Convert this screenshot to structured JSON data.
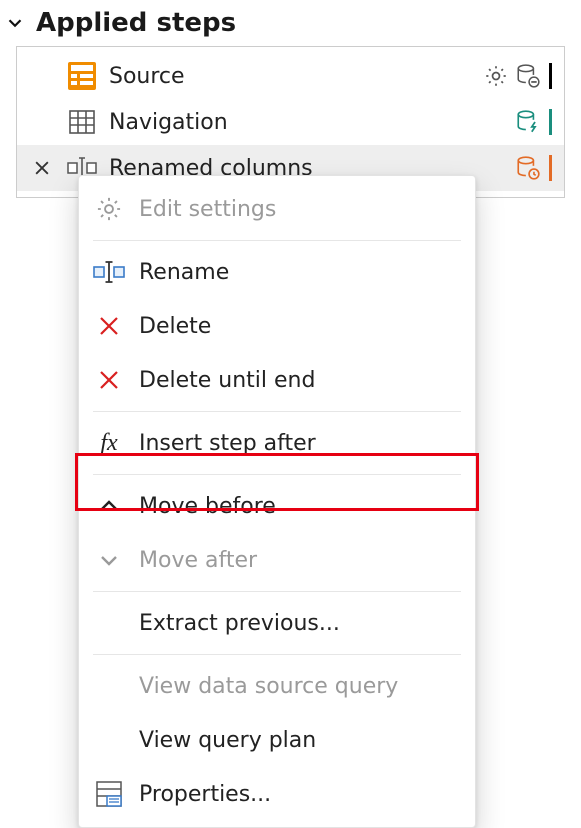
{
  "header": {
    "title": "Applied steps"
  },
  "steps": {
    "source": {
      "label": "Source"
    },
    "navigation": {
      "label": "Navigation"
    },
    "renamed": {
      "label": "Renamed columns"
    }
  },
  "context_menu": {
    "edit_settings": {
      "label": "Edit settings"
    },
    "rename": {
      "label": "Rename"
    },
    "delete": {
      "label": "Delete"
    },
    "delete_until_end": {
      "label": "Delete until end"
    },
    "insert_step_after": {
      "label": "Insert step after"
    },
    "move_before": {
      "label": "Move before"
    },
    "move_after": {
      "label": "Move after"
    },
    "extract_previous": {
      "label": "Extract previous..."
    },
    "view_ds_query": {
      "label": "View data source query"
    },
    "view_query_plan": {
      "label": "View query plan"
    },
    "properties": {
      "label": "Properties..."
    }
  },
  "colors": {
    "accent_source": "#000000",
    "accent_nav": "#1a8e7e",
    "accent_renamed": "#e36b26"
  }
}
